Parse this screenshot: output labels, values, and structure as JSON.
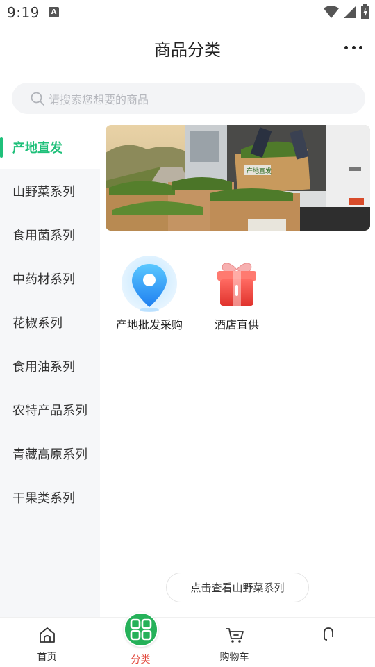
{
  "status_bar": {
    "time": "9:19",
    "a_badge": "A"
  },
  "header": {
    "title": "商品分类"
  },
  "search": {
    "placeholder": "请搜索您想要的商品"
  },
  "sidebar": {
    "items": [
      {
        "label": "产地直发",
        "active": true
      },
      {
        "label": "山野菜系列",
        "active": false
      },
      {
        "label": "食用菌系列",
        "active": false
      },
      {
        "label": "中药材系列",
        "active": false
      },
      {
        "label": "花椒系列",
        "active": false
      },
      {
        "label": "食用油系列",
        "active": false
      },
      {
        "label": "农特产品系列",
        "active": false
      },
      {
        "label": "青藏高原系列",
        "active": false
      },
      {
        "label": "干果类系列",
        "active": false
      }
    ]
  },
  "banner": {
    "box_text": "产地直发"
  },
  "categories": [
    {
      "label": "产地批发采购",
      "icon": "location-pin-icon"
    },
    {
      "label": "酒店直供",
      "icon": "gift-box-icon"
    }
  ],
  "view_series_button": "点击查看山野菜系列",
  "bottom_nav": {
    "items": [
      {
        "label": "首页",
        "icon": "home-icon",
        "active": false
      },
      {
        "label": "分类",
        "icon": "grid-icon",
        "active": true
      },
      {
        "label": "购物车",
        "icon": "cart-icon",
        "active": false
      },
      {
        "label": "",
        "icon": "headset-icon",
        "active": false
      }
    ]
  },
  "colors": {
    "accent_green": "#1fc07a",
    "nav_active_circle": "#25b159",
    "nav_active_label": "#e2473b",
    "sidebar_bg": "#f6f7f9",
    "search_bg": "#f3f4f6"
  }
}
